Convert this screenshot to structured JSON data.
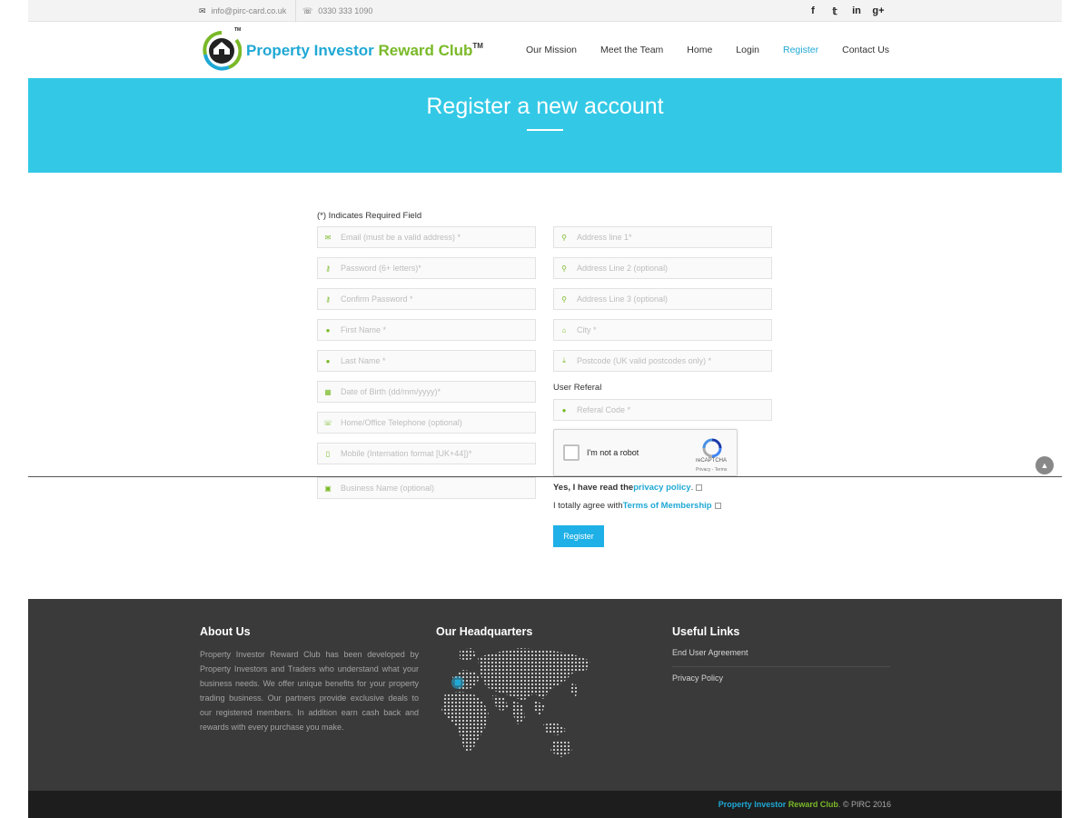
{
  "topbar": {
    "email": "info@pirc-card.co.uk",
    "phone": "0330 333 1090",
    "socials": [
      "facebook-icon",
      "twitter-icon",
      "linkedin-icon",
      "google-plus-icon"
    ]
  },
  "brand": {
    "name_part1": "Property Investor ",
    "name_part2": "Reward Club",
    "tm": "TM",
    "logo_tm": "TM"
  },
  "nav": {
    "items": [
      "Our Mission",
      "Meet the Team",
      "Home",
      "Login",
      "Register",
      "Contact Us"
    ],
    "active": "Register"
  },
  "banner": {
    "title": "Register a new account"
  },
  "form": {
    "required_note": "(*) Indicates Required Field",
    "left_fields": [
      {
        "icon": "envelope-icon",
        "placeholder": "Email (must be a valid address) *"
      },
      {
        "icon": "key-icon",
        "placeholder": "Password (6+ letters)*"
      },
      {
        "icon": "key-icon",
        "placeholder": "Confirm Password *"
      },
      {
        "icon": "user-icon",
        "placeholder": "First Name *"
      },
      {
        "icon": "user-icon",
        "placeholder": "Last Name *"
      },
      {
        "icon": "calendar-icon",
        "placeholder": "Date of Birth (dd/mm/yyyy)*"
      },
      {
        "icon": "phone-icon",
        "placeholder": "Home/Office Telephone (optional)"
      },
      {
        "icon": "mobile-icon",
        "placeholder": "Mobile (Internation format [UK+44])*"
      },
      {
        "icon": "money-icon",
        "placeholder": "Business Name (optional)"
      }
    ],
    "right_fields": [
      {
        "icon": "map-marker-icon",
        "placeholder": "Address line 1*"
      },
      {
        "icon": "map-marker-icon",
        "placeholder": "Address Line 2 (optional)"
      },
      {
        "icon": "map-marker-icon",
        "placeholder": "Address Line 3 (optional)"
      },
      {
        "icon": "home-icon",
        "placeholder": "City *"
      },
      {
        "icon": "download-icon",
        "placeholder": "Postcode (UK valid postcodes only) *"
      }
    ],
    "referral_label": "User Referal",
    "referral_field": {
      "icon": "user-icon",
      "placeholder": "Referal Code *"
    },
    "captcha": {
      "label": "I'm not a robot",
      "brand": "reCAPTCHA",
      "terms": "Privacy - Terms"
    },
    "privacy": {
      "pre": "Yes, I have read the ",
      "link": "privacy policy",
      "post": "."
    },
    "terms": {
      "pre": "I totally agree with ",
      "link": "Terms of Membership"
    },
    "submit_label": "Register"
  },
  "footer": {
    "about_title": "About Us",
    "about_text": "Property Investor Reward Club has been developed by Property Investors and Traders who understand what your business needs. We offer unique benefits for your property trading business. Our partners provide exclusive deals to our registered members. In addition earn cash back and rewards with every purchase you make.",
    "hq_title": "Our Headquarters",
    "links_title": "Useful Links",
    "links": [
      "End User Agreement",
      "Privacy Policy"
    ]
  },
  "copyright": {
    "brand_part1": "Property Investor ",
    "brand_part2": "Reward Club",
    "rest": ". © PIRC 2016"
  },
  "colors": {
    "accent_blue": "#1fa8d5",
    "accent_green": "#7ab928",
    "banner": "#33c9e6",
    "footer": "#3a3a3a"
  }
}
